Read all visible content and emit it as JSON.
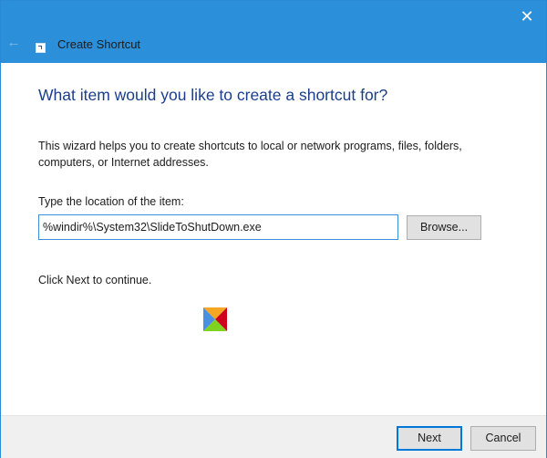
{
  "window": {
    "title": "Create Shortcut",
    "back_icon": "back-arrow-icon",
    "close_icon": "close-icon",
    "back_glyph": "←",
    "close_glyph": "✕",
    "accent_color": "#2b90d9"
  },
  "wizard": {
    "heading": "What item would you like to create a shortcut for?",
    "description": "This wizard helps you to create shortcuts to local or network programs, files, folders, computers, or Internet addresses.",
    "location_label": "Type the location of the item:",
    "location_value": "%windir%\\System32\\SlideToShutDown.exe",
    "browse_label": "Browse...",
    "continue_text": "Click Next to continue."
  },
  "footer": {
    "next_label": "Next",
    "cancel_label": "Cancel"
  },
  "logo": {
    "icon": "watermark-logo-icon",
    "colors": [
      "#f5a623",
      "#d0021b",
      "#4a90e2",
      "#7ed321"
    ]
  }
}
